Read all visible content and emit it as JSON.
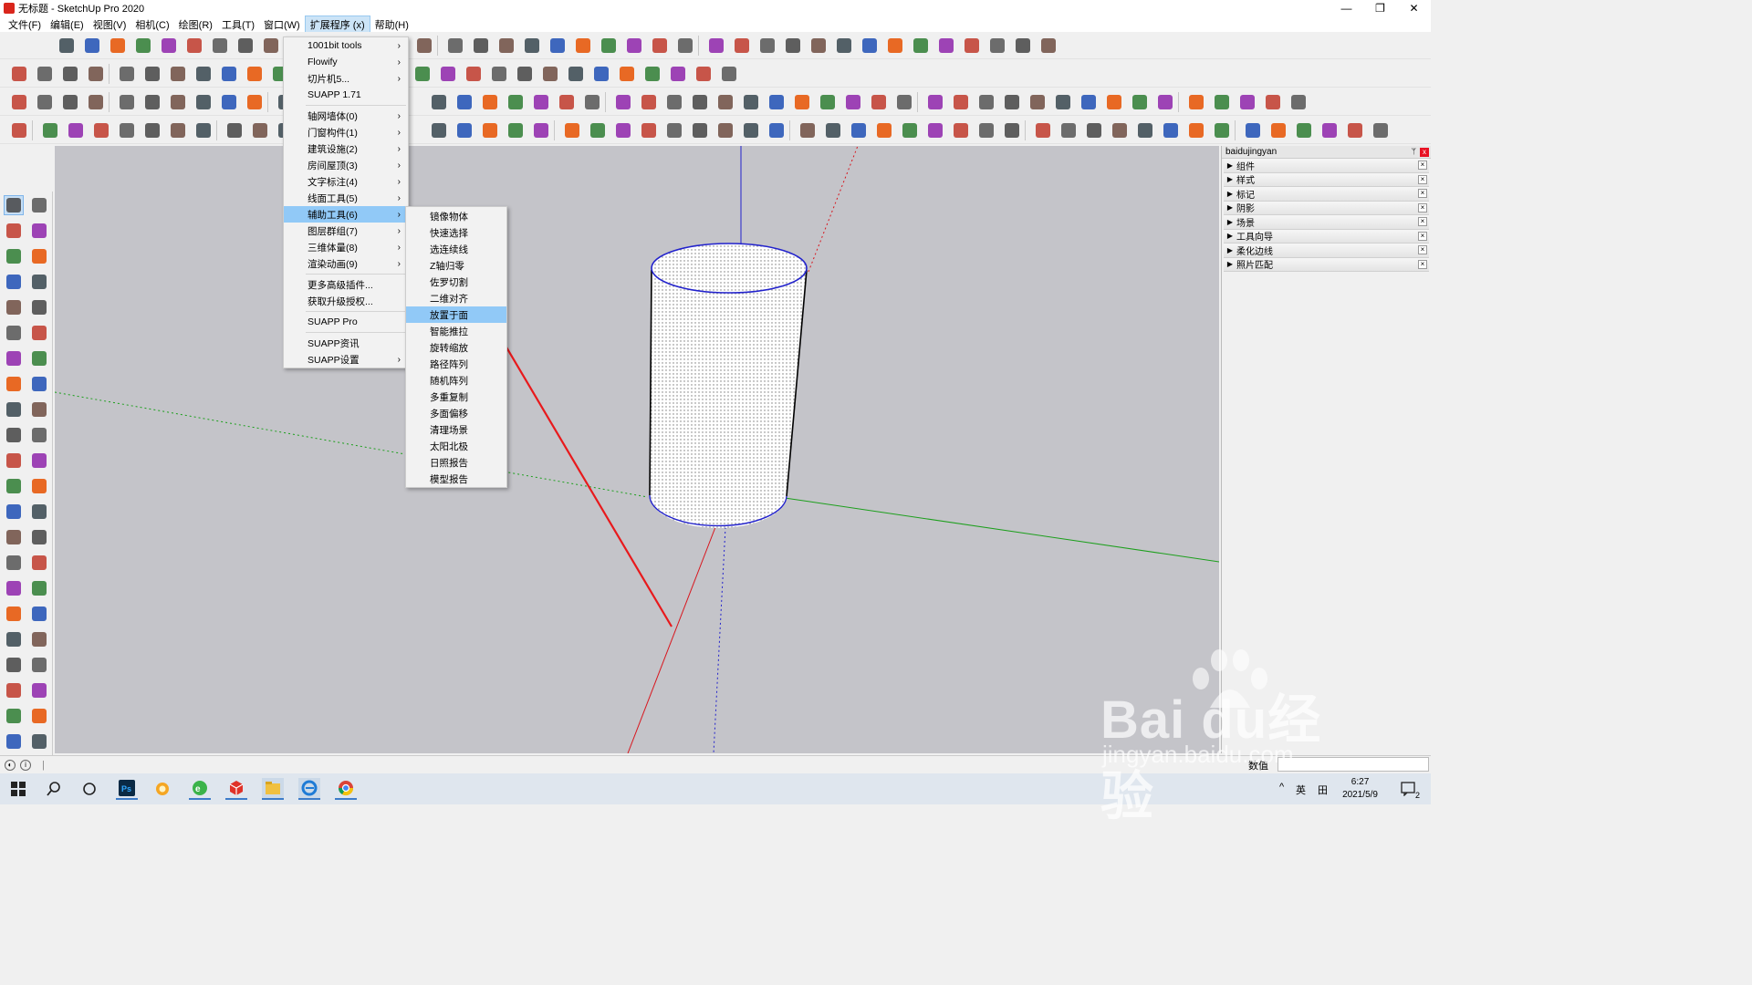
{
  "window": {
    "title": "无标题 - SketchUp Pro 2020",
    "minimize": "—",
    "restore": "❐",
    "close": "✕"
  },
  "menubar": [
    {
      "label": "文件(F)",
      "active": false
    },
    {
      "label": "编辑(E)",
      "active": false
    },
    {
      "label": "视图(V)",
      "active": false
    },
    {
      "label": "相机(C)",
      "active": false
    },
    {
      "label": "绘图(R)",
      "active": false
    },
    {
      "label": "工具(T)",
      "active": false
    },
    {
      "label": "窗口(W)",
      "active": false
    },
    {
      "label": "扩展程序 (x)",
      "active": true
    },
    {
      "label": "帮助(H)",
      "active": false
    }
  ],
  "extensions_menu": {
    "items": [
      {
        "label": "1001bit tools",
        "submenu": true
      },
      {
        "label": "Flowify",
        "submenu": true
      },
      {
        "label": "切片机5...",
        "submenu": true
      },
      {
        "label": "SUAPP 1.71",
        "submenu": false
      },
      {
        "sep": true
      },
      {
        "label": "轴网墙体(0)",
        "submenu": true
      },
      {
        "label": "门窗构件(1)",
        "submenu": true
      },
      {
        "label": "建筑设施(2)",
        "submenu": true
      },
      {
        "label": "房间屋顶(3)",
        "submenu": true
      },
      {
        "label": "文字标注(4)",
        "submenu": true
      },
      {
        "label": "线面工具(5)",
        "submenu": true
      },
      {
        "label": "辅助工具(6)",
        "submenu": true,
        "highlight": true
      },
      {
        "label": "图层群组(7)",
        "submenu": true
      },
      {
        "label": "三维体量(8)",
        "submenu": true
      },
      {
        "label": "渲染动画(9)",
        "submenu": true
      },
      {
        "sep": true
      },
      {
        "label": "更多高级插件...",
        "submenu": false
      },
      {
        "label": "获取升级授权...",
        "submenu": false
      },
      {
        "sep": true
      },
      {
        "label": "SUAPP Pro",
        "submenu": false
      },
      {
        "sep": true
      },
      {
        "label": "SUAPP资讯",
        "submenu": false
      },
      {
        "label": "SUAPP设置",
        "submenu": true
      }
    ]
  },
  "aux_tools_submenu": {
    "items": [
      {
        "label": "镜像物体"
      },
      {
        "label": "快速选择"
      },
      {
        "label": "选连续线"
      },
      {
        "label": "Z轴归零"
      },
      {
        "label": "佐罗切割"
      },
      {
        "label": "二维对齐"
      },
      {
        "label": "放置于面",
        "highlight": true
      },
      {
        "label": "智能推拉"
      },
      {
        "label": "旋转缩放"
      },
      {
        "label": "路径阵列"
      },
      {
        "label": "随机阵列"
      },
      {
        "label": "多重复制"
      },
      {
        "label": "多面偏移"
      },
      {
        "label": "清理场景"
      },
      {
        "label": "太阳北极"
      },
      {
        "label": "日照报告"
      },
      {
        "label": "模型报告"
      }
    ]
  },
  "tray": {
    "title": "baidujingyan",
    "pin": "ᛘ",
    "close": "x",
    "panels": [
      {
        "label": "组件"
      },
      {
        "label": "样式"
      },
      {
        "label": "标记"
      },
      {
        "label": "阴影"
      },
      {
        "label": "场景"
      },
      {
        "label": "工具向导"
      },
      {
        "label": "柔化边线"
      },
      {
        "label": "照片匹配"
      }
    ]
  },
  "statusbar": {
    "geo_icon": "◐",
    "info_icon": "i",
    "divider": "|",
    "measurements_label": "数值"
  },
  "taskbar": {
    "ime": "英",
    "ime2": "田",
    "caret": "^",
    "time": "6:27",
    "date": "2021/5/9",
    "notifications": "2"
  },
  "watermark": {
    "main": "Bai du经验",
    "sub": "jingyan.baidu.com"
  },
  "colors": {
    "viewport_bg": "#c4c4c9",
    "menu_highlight": "#91c9f7",
    "axis_red": "#d8151d",
    "axis_green": "#1c9f1c",
    "axis_blue": "#2222cc",
    "arrow": "#e8191c"
  }
}
